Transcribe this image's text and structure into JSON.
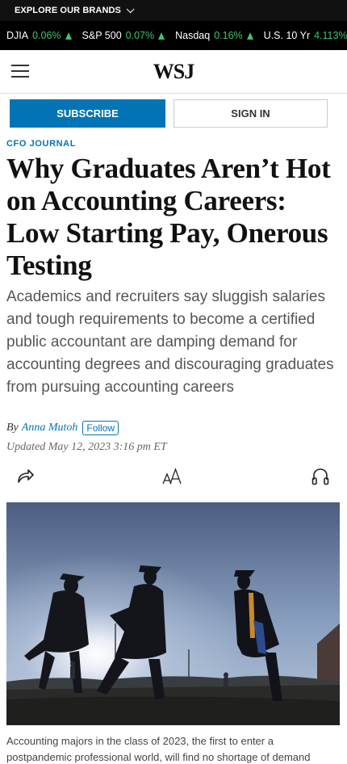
{
  "brands_bar": {
    "label": "EXPLORE OUR BRANDS"
  },
  "ticker": [
    {
      "symbol": "DJIA",
      "change": "0.06%"
    },
    {
      "symbol": "S&P 500",
      "change": "0.07%"
    },
    {
      "symbol": "Nasdaq",
      "change": "0.16%"
    },
    {
      "symbol": "U.S. 10 Yr",
      "change": "4.113%"
    }
  ],
  "masthead": {
    "logo": "WSJ"
  },
  "auth": {
    "subscribe_label": "SUBSCRIBE",
    "signin_label": "SIGN IN"
  },
  "article": {
    "section": "CFO JOURNAL",
    "headline": "Why Graduates Aren’t Hot on Accounting Careers: Low Starting Pay, Onerous Testing",
    "dek": "Academics and recruiters say sluggish salaries and tough requirements to become a certified public accountant are damping demand for accounting degrees and discouraging graduates from pursuing accounting careers",
    "by_prefix": "By",
    "author": "Anna Mutoh",
    "follow_label": "Follow",
    "timestamp": "Updated May 12, 2023 3:16 pm ET",
    "caption": "Accounting majors in the class of 2023, the first to enter a postpandemic professional world, will find no shortage of demand"
  },
  "icons": {
    "share": "share-icon",
    "text_size": "text-size-icon",
    "audio": "headphones-icon"
  },
  "colors": {
    "accent": "#0274b6",
    "ticker_up": "#3ec46d"
  }
}
